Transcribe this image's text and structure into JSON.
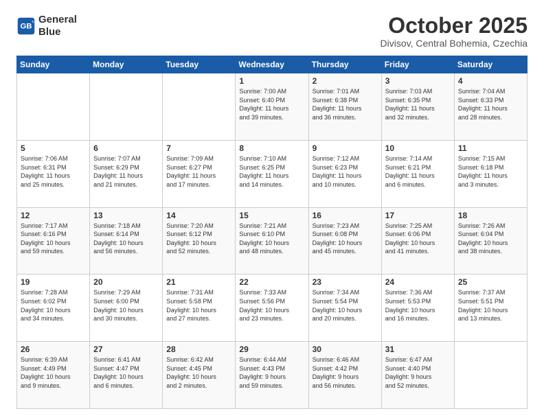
{
  "logo": {
    "line1": "General",
    "line2": "Blue"
  },
  "header": {
    "month": "October 2025",
    "location": "Divisov, Central Bohemia, Czechia"
  },
  "weekdays": [
    "Sunday",
    "Monday",
    "Tuesday",
    "Wednesday",
    "Thursday",
    "Friday",
    "Saturday"
  ],
  "weeks": [
    [
      {
        "day": "",
        "info": ""
      },
      {
        "day": "",
        "info": ""
      },
      {
        "day": "",
        "info": ""
      },
      {
        "day": "1",
        "info": "Sunrise: 7:00 AM\nSunset: 6:40 PM\nDaylight: 11 hours\nand 39 minutes."
      },
      {
        "day": "2",
        "info": "Sunrise: 7:01 AM\nSunset: 6:38 PM\nDaylight: 11 hours\nand 36 minutes."
      },
      {
        "day": "3",
        "info": "Sunrise: 7:03 AM\nSunset: 6:35 PM\nDaylight: 11 hours\nand 32 minutes."
      },
      {
        "day": "4",
        "info": "Sunrise: 7:04 AM\nSunset: 6:33 PM\nDaylight: 11 hours\nand 28 minutes."
      }
    ],
    [
      {
        "day": "5",
        "info": "Sunrise: 7:06 AM\nSunset: 6:31 PM\nDaylight: 11 hours\nand 25 minutes."
      },
      {
        "day": "6",
        "info": "Sunrise: 7:07 AM\nSunset: 6:29 PM\nDaylight: 11 hours\nand 21 minutes."
      },
      {
        "day": "7",
        "info": "Sunrise: 7:09 AM\nSunset: 6:27 PM\nDaylight: 11 hours\nand 17 minutes."
      },
      {
        "day": "8",
        "info": "Sunrise: 7:10 AM\nSunset: 6:25 PM\nDaylight: 11 hours\nand 14 minutes."
      },
      {
        "day": "9",
        "info": "Sunrise: 7:12 AM\nSunset: 6:23 PM\nDaylight: 11 hours\nand 10 minutes."
      },
      {
        "day": "10",
        "info": "Sunrise: 7:14 AM\nSunset: 6:21 PM\nDaylight: 11 hours\nand 6 minutes."
      },
      {
        "day": "11",
        "info": "Sunrise: 7:15 AM\nSunset: 6:18 PM\nDaylight: 11 hours\nand 3 minutes."
      }
    ],
    [
      {
        "day": "12",
        "info": "Sunrise: 7:17 AM\nSunset: 6:16 PM\nDaylight: 10 hours\nand 59 minutes."
      },
      {
        "day": "13",
        "info": "Sunrise: 7:18 AM\nSunset: 6:14 PM\nDaylight: 10 hours\nand 56 minutes."
      },
      {
        "day": "14",
        "info": "Sunrise: 7:20 AM\nSunset: 6:12 PM\nDaylight: 10 hours\nand 52 minutes."
      },
      {
        "day": "15",
        "info": "Sunrise: 7:21 AM\nSunset: 6:10 PM\nDaylight: 10 hours\nand 48 minutes."
      },
      {
        "day": "16",
        "info": "Sunrise: 7:23 AM\nSunset: 6:08 PM\nDaylight: 10 hours\nand 45 minutes."
      },
      {
        "day": "17",
        "info": "Sunrise: 7:25 AM\nSunset: 6:06 PM\nDaylight: 10 hours\nand 41 minutes."
      },
      {
        "day": "18",
        "info": "Sunrise: 7:26 AM\nSunset: 6:04 PM\nDaylight: 10 hours\nand 38 minutes."
      }
    ],
    [
      {
        "day": "19",
        "info": "Sunrise: 7:28 AM\nSunset: 6:02 PM\nDaylight: 10 hours\nand 34 minutes."
      },
      {
        "day": "20",
        "info": "Sunrise: 7:29 AM\nSunset: 6:00 PM\nDaylight: 10 hours\nand 30 minutes."
      },
      {
        "day": "21",
        "info": "Sunrise: 7:31 AM\nSunset: 5:58 PM\nDaylight: 10 hours\nand 27 minutes."
      },
      {
        "day": "22",
        "info": "Sunrise: 7:33 AM\nSunset: 5:56 PM\nDaylight: 10 hours\nand 23 minutes."
      },
      {
        "day": "23",
        "info": "Sunrise: 7:34 AM\nSunset: 5:54 PM\nDaylight: 10 hours\nand 20 minutes."
      },
      {
        "day": "24",
        "info": "Sunrise: 7:36 AM\nSunset: 5:53 PM\nDaylight: 10 hours\nand 16 minutes."
      },
      {
        "day": "25",
        "info": "Sunrise: 7:37 AM\nSunset: 5:51 PM\nDaylight: 10 hours\nand 13 minutes."
      }
    ],
    [
      {
        "day": "26",
        "info": "Sunrise: 6:39 AM\nSunset: 4:49 PM\nDaylight: 10 hours\nand 9 minutes."
      },
      {
        "day": "27",
        "info": "Sunrise: 6:41 AM\nSunset: 4:47 PM\nDaylight: 10 hours\nand 6 minutes."
      },
      {
        "day": "28",
        "info": "Sunrise: 6:42 AM\nSunset: 4:45 PM\nDaylight: 10 hours\nand 2 minutes."
      },
      {
        "day": "29",
        "info": "Sunrise: 6:44 AM\nSunset: 4:43 PM\nDaylight: 9 hours\nand 59 minutes."
      },
      {
        "day": "30",
        "info": "Sunrise: 6:46 AM\nSunset: 4:42 PM\nDaylight: 9 hours\nand 56 minutes."
      },
      {
        "day": "31",
        "info": "Sunrise: 6:47 AM\nSunset: 4:40 PM\nDaylight: 9 hours\nand 52 minutes."
      },
      {
        "day": "",
        "info": ""
      }
    ]
  ]
}
